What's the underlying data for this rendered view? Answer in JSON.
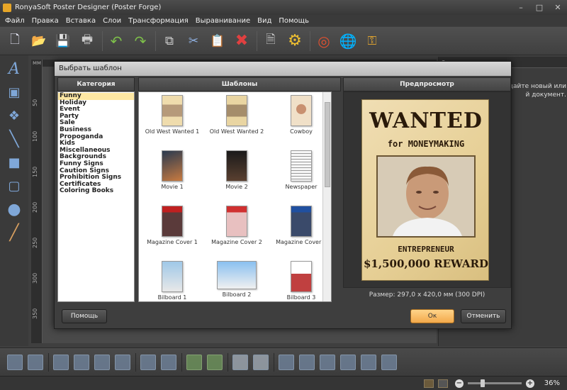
{
  "window": {
    "title": "RonyaSoft Poster Designer (Poster Forge)"
  },
  "menu": [
    "Файл",
    "Правка",
    "Вставка",
    "Слои",
    "Трансформация",
    "Выравнивание",
    "Вид",
    "Помощь"
  ],
  "toolbar": [
    "new-document-icon",
    "open-folder-icon",
    "save-icon",
    "print-icon",
    "undo-icon",
    "redo-icon",
    "copy-icon",
    "cut-icon",
    "paste-icon",
    "delete-icon",
    "page-settings-icon",
    "gear-icon",
    "help-lifebuoy-icon",
    "globe-icon",
    "key-icon"
  ],
  "ruler": {
    "unit": "мм",
    "marks": [
      "50",
      "100",
      "150",
      "200",
      "250",
      "300",
      "350"
    ]
  },
  "right_panel": {
    "tab": "а",
    "text": "дайте новый или\nй документ."
  },
  "dialog": {
    "title": "Выбрать шаблон",
    "headers": {
      "category": "Категория",
      "templates": "Шаблоны",
      "preview": "Предпросмотр"
    },
    "categories": [
      "Funny",
      "Holiday",
      "Event",
      "Party",
      "Sale",
      "Business",
      "Propoganda",
      "Kids",
      "Miscellaneous",
      "Backgrounds",
      "Funny Signs",
      "Caution Signs",
      "Prohibition Signs",
      "Certificates",
      "Coloring Books"
    ],
    "selected_category": "Funny",
    "templates": [
      "Old West Wanted 1",
      "Old West Wanted 2",
      "Cowboy",
      "Movie 1",
      "Movie 2",
      "Newspaper",
      "Magazine Cover 1",
      "Magazine Cover 2",
      "Magazine Cover 3",
      "Bilboard 1",
      "Bilboard 2",
      "Bilboard 3"
    ],
    "preview_poster": {
      "line1": "WANTED",
      "line2": "for MONEYMAKING",
      "line3": "ENTREPRENEUR",
      "line4": "$1,500,000 REWARD"
    },
    "size_info": "Размер: 297,0 x 420,0 мм (300 DPI)",
    "buttons": {
      "help": "Помощь",
      "ok": "Ок",
      "cancel": "Отменить"
    }
  },
  "status": {
    "zoom": "36%"
  }
}
